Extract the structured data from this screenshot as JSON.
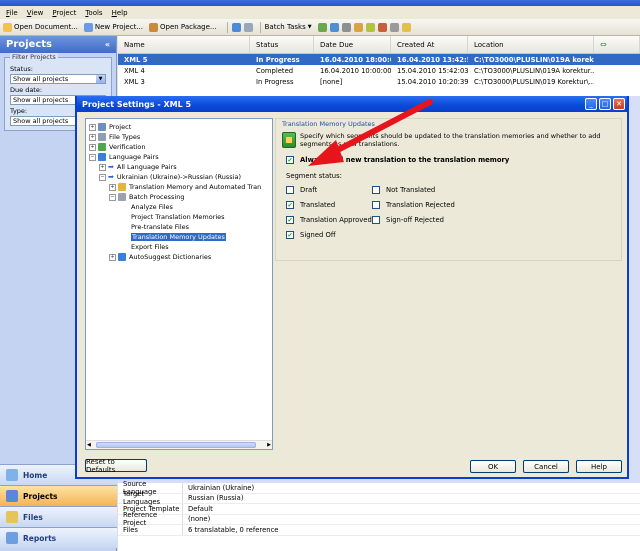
{
  "menu": [
    "File",
    "View",
    "Project",
    "Tools",
    "Help"
  ],
  "toolbar": {
    "open_document": "Open Document...",
    "new_project": "New Project...",
    "open_package": "Open Package...",
    "batch_tasks": "Batch Tasks"
  },
  "nav": {
    "title": "Projects",
    "collapse": "«",
    "filter_title": "Filter Projects",
    "status_label": "Status:",
    "status_value": "Show all projects",
    "due_label": "Due date:",
    "due_value": "Show all projects",
    "type_label": "Type:",
    "type_value": "Show all projects",
    "buttons": [
      "Home",
      "Projects",
      "Files",
      "Reports"
    ]
  },
  "grid": {
    "columns": [
      "Name",
      "Status",
      "Date Due",
      "Created At",
      "Location"
    ],
    "rows": [
      [
        "XML 5",
        "In Progress",
        "16.04.2010 18:00:00",
        "16.04.2010 13:42:51",
        "C:\\TO3000\\PLUSLIN\\019A korekt..."
      ],
      [
        "XML 4",
        "Completed",
        "16.04.2010 10:00:00",
        "15.04.2010 15:42:03",
        "C:\\TO3000\\PLUSLIN\\019A korektur..."
      ],
      [
        "XML 3",
        "In Progress",
        "[none]",
        "15.04.2010 10:20:39",
        "C:\\TO3000\\PLUSLIN\\019 Korektur\\..."
      ]
    ]
  },
  "props": [
    [
      "Source Language",
      "Ukrainian (Ukraine)"
    ],
    [
      "Target Languages",
      "Russian (Russia)"
    ],
    [
      "Project Template",
      "Default"
    ],
    [
      "Reference Project",
      "(none)"
    ],
    [
      "Files",
      "6 translatable, 0 reference"
    ]
  ],
  "dialog": {
    "title": "Project Settings - XML 5",
    "tree": [
      "Project",
      "File Types",
      "Verification",
      "Language Pairs",
      "All Language Pairs",
      "Ukrainian (Ukraine)->Russian (Russia)",
      "Translation Memory and Automated Tran",
      "Batch Processing",
      "Analyze Files",
      "Project Translation Memories",
      "Pre-translate Files",
      "Translation Memory Updates",
      "Export Files",
      "AutoSuggest Dictionaries"
    ],
    "panel_title": "Translation Memory Updates",
    "panel_desc": "Specify which segments should be updated to the translation memories and whether to add segments as new translations.",
    "always_add": "Always add new translation to the translation memory",
    "segment_status": "Segment status:",
    "statuses_left": [
      "Draft",
      "Translated",
      "Translation Approved",
      "Signed Off"
    ],
    "statuses_left_checked": [
      false,
      true,
      true,
      true
    ],
    "statuses_right": [
      "Not Translated",
      "Translation Rejected",
      "Sign-off Rejected"
    ],
    "statuses_right_checked": [
      false,
      false,
      false
    ],
    "reset": "Reset to Defaults",
    "ok": "OK",
    "cancel": "Cancel",
    "help": "Help"
  },
  "colors": {
    "selection": "#316ac5",
    "dialog_title": "#0a4ad8",
    "arrow": "#e8141c"
  }
}
